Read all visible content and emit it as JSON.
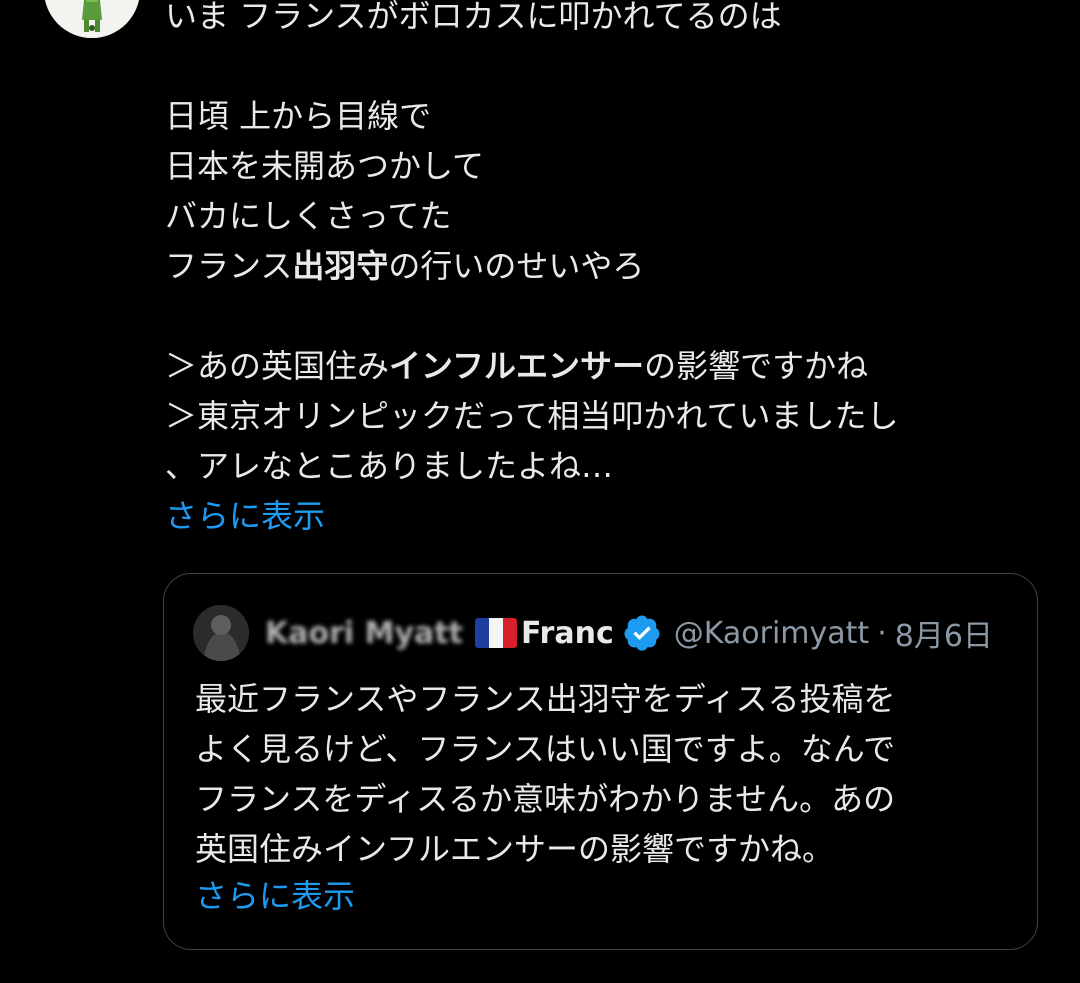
{
  "tweet": {
    "lines": [
      "いま フランスがボロカスに叩かれてるのは",
      "",
      "日頃 上から目線で",
      "日本を未開あつかして",
      "バカにしくさってた"
    ],
    "line6_prefix": "フランス",
    "line6_bold": "出羽守",
    "line6_suffix": "の行いのせいやろ",
    "line8_prefix": "＞あの英国住み",
    "line8_bold": "インフルエンサー",
    "line8_suffix": "の影響ですかね",
    "line9": "＞東京オリンピックだって相当叩かれていましたし",
    "line10": "、アレなとこありましたよね…",
    "show_more": "さらに表示"
  },
  "quote": {
    "author_name": "Kaori Myatt",
    "name_suffix": "Franc",
    "handle": "@Kaorimyatt",
    "separator": "·",
    "date": "8月6日",
    "lines": [
      "最近フランスやフランス出羽守をディスる投稿を",
      "よく見るけど、フランスはいい国ですよ。なんで",
      "フランスをディスるか意味がわかりません。あの",
      "英国住みインフルエンサーの影響ですかね。"
    ],
    "show_more": "さらに表示"
  },
  "colors": {
    "background": "#000000",
    "text": "#e7e9ea",
    "link": "#1d9bf0",
    "muted": "#8b98a5",
    "border": "#3e4144",
    "verified": "#1d9bf0"
  },
  "icons": {
    "flag": "france-flag-icon",
    "verified": "verified-badge-icon"
  }
}
